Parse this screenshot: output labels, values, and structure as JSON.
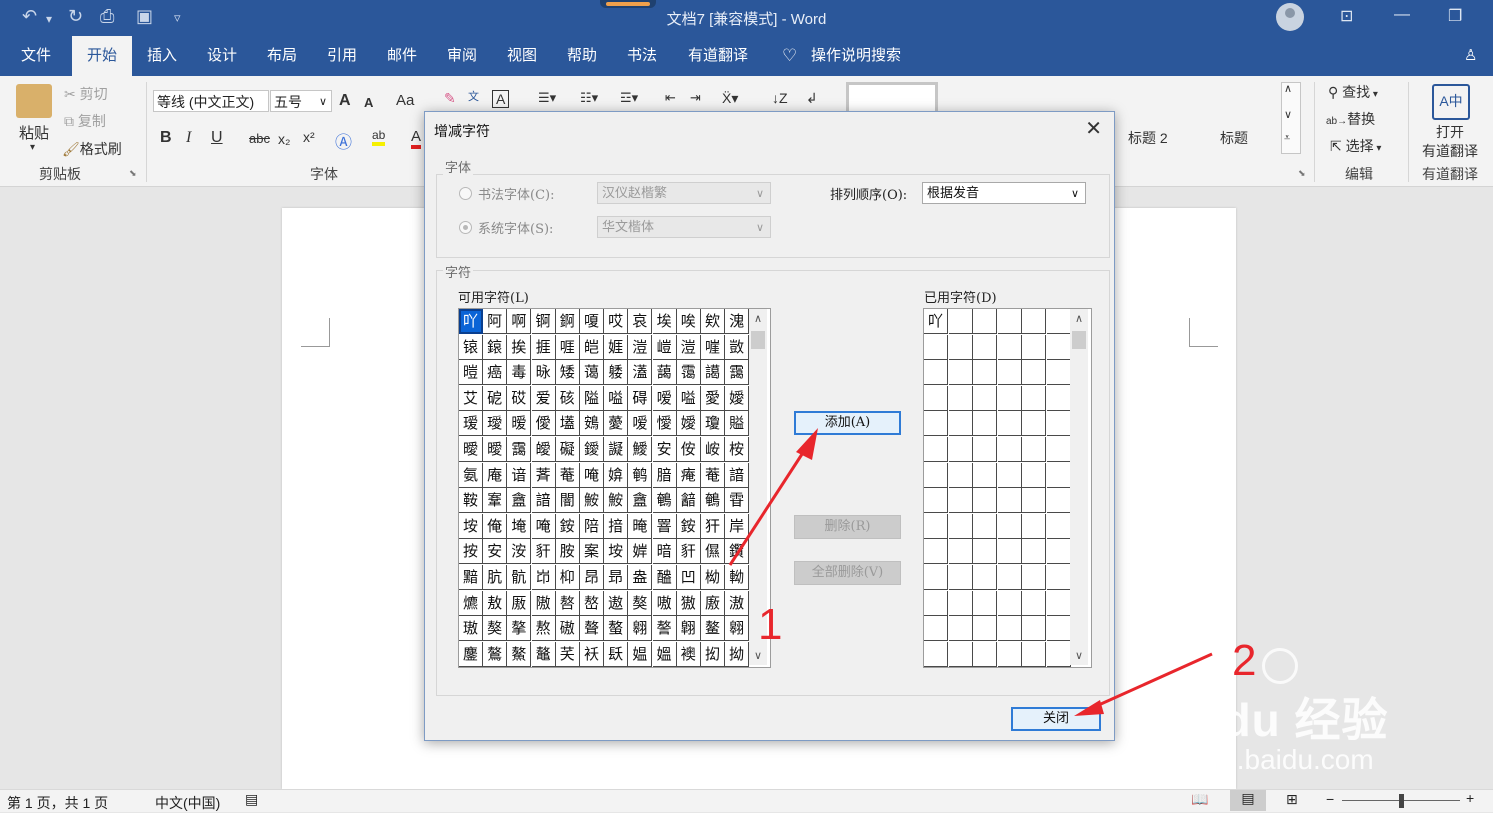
{
  "window": {
    "title": "文档7 [兼容模式] - Word",
    "qat": [
      "↶",
      "↷",
      "⎙",
      "🖫",
      "▿"
    ]
  },
  "tabs": [
    "文件",
    "开始",
    "插入",
    "设计",
    "布局",
    "引用",
    "邮件",
    "审阅",
    "视图",
    "帮助",
    "书法",
    "有道翻译"
  ],
  "tab_search": "操作说明搜索",
  "share_label": "共",
  "ribbon": {
    "clipboard": {
      "paste": "粘贴",
      "cut": "剪切",
      "copy": "复制",
      "format_painter": "格式刷",
      "group": "剪贴板"
    },
    "font": {
      "font_name": "等线 (中文正文)",
      "font_size": "五号",
      "grow": "A",
      "shrink": "A",
      "change_case": "Aa",
      "bold": "B",
      "italic": "I",
      "underline": "U",
      "strike": "abc",
      "subscript": "x₂",
      "superscript": "x²",
      "group": "字体"
    },
    "styles": {
      "heading2": "标题 2",
      "title": "标题"
    },
    "editing": {
      "find": "查找",
      "replace": "替换",
      "select": "选择",
      "group": "编辑"
    },
    "youdao": {
      "open_line1": "打开",
      "open_line2": "有道翻译",
      "group": "有道翻译"
    }
  },
  "statusbar": {
    "page": "第 1 页，共 1 页",
    "lang": "中文(中国)"
  },
  "dialog": {
    "title": "增减字符",
    "font_group": "字体",
    "calligraphy_font_label": "书法字体(C):",
    "calligraphy_font_value": "汉仪赵楷繁",
    "system_font_label": "系统字体(S):",
    "system_font_value": "华文楷体",
    "sort_label": "排列顺序(O):",
    "sort_value": "根据发音",
    "chars_group": "字符",
    "available_label": "可用字符(L)",
    "used_label": "已用字符(D)",
    "add_button": "添加(A)",
    "delete_button": "删除(R)",
    "delete_all_button": "全部删除(V)",
    "close_button": "关闭",
    "available_chars": [
      [
        "吖",
        "阿",
        "啊",
        "锕",
        "錒",
        "嗄",
        "哎",
        "哀",
        "埃",
        "唉",
        "欸",
        "溾"
      ],
      [
        "锿",
        "鎄",
        "挨",
        "捱",
        "啀",
        "皑",
        "娾",
        "溰",
        "嵦",
        "溰",
        "嘊",
        "敳"
      ],
      [
        "暟",
        "癌",
        "毒",
        "昹",
        "矮",
        "蔼",
        "躷",
        "濭",
        "藹",
        "霭",
        "譪",
        "靄"
      ],
      [
        "艾",
        "砨",
        "砹",
        "爱",
        "硋",
        "隘",
        "嗌",
        "碍",
        "嗳",
        "嗌",
        "愛",
        "嬡"
      ],
      [
        "瑷",
        "璦",
        "暧",
        "僾",
        "壒",
        "鴳",
        "薆",
        "嗳",
        "懓",
        "嬡",
        "瓊",
        "賹"
      ],
      [
        "曖",
        "曖",
        "靄",
        "皧",
        "礙",
        "鑀",
        "譺",
        "鱫",
        "安",
        "侒",
        "峖",
        "桉"
      ],
      [
        "氨",
        "庵",
        "谙",
        "萕",
        "菴",
        "唵",
        "媕",
        "鹌",
        "腤",
        "痷",
        "菴",
        "諳"
      ],
      [
        "鞍",
        "鞌",
        "盦",
        "諳",
        "闇",
        "鮟",
        "鮟",
        "盦",
        "鵪",
        "韽",
        "鵪",
        "雸"
      ],
      [
        "垵",
        "俺",
        "埯",
        "唵",
        "銨",
        "陪",
        "揞",
        "晻",
        "罯",
        "銨",
        "犴",
        "岸"
      ],
      [
        "按",
        "安",
        "洝",
        "豻",
        "胺",
        "案",
        "垵",
        "婩",
        "暗",
        "豻",
        "儑",
        "鑦"
      ],
      [
        "黯",
        "肮",
        "骯",
        "岇",
        "枊",
        "昂",
        "昻",
        "盎",
        "醠",
        "凹",
        "柪",
        "軪"
      ],
      [
        "爊",
        "敖",
        "厫",
        "隞",
        "嗸",
        "嶅",
        "遨",
        "獒",
        "嗷",
        "獓",
        "廒",
        "滶"
      ],
      [
        "璈",
        "獒",
        "摮",
        "熬",
        "磝",
        "聱",
        "螯",
        "翱",
        "謷",
        "翺",
        "鳌",
        "翱"
      ],
      [
        "鏖",
        "鷔",
        "鰲",
        "鼇",
        "芺",
        "袄",
        "镺",
        "媪",
        "媼",
        "襖",
        "抝",
        "拗"
      ]
    ],
    "used_chars": [
      "吖"
    ]
  },
  "annotations": {
    "one": "1",
    "two": "2"
  },
  "watermark": {
    "brand": "Baidu 经验",
    "url": "jingyan.baidu.com"
  }
}
